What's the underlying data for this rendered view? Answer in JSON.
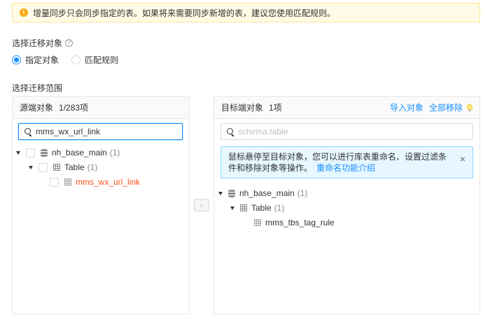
{
  "notice": {
    "text": "增量同步只会同步指定的表。如果将来需要同步新增的表，建议您使用匹配规则。",
    "icon": "exclamation-circle-icon"
  },
  "object_section": {
    "label": "选择迁移对象",
    "help_glyph": "?",
    "options": [
      {
        "label": "指定对象",
        "checked": true
      },
      {
        "label": "匹配规则",
        "checked": false
      }
    ]
  },
  "scope_section": {
    "label": "选择迁移范围"
  },
  "source_panel": {
    "title": "源端对象",
    "count": "1/283项",
    "search_value": "mms_wx_url_link",
    "tree": [
      {
        "label": "nh_base_main",
        "count": "(1)",
        "level": 0,
        "icon": "database-icon"
      },
      {
        "label": "Table",
        "count": "(1)",
        "level": 1,
        "icon": "table-group-icon"
      },
      {
        "label": "mms_wx_url_link",
        "count": "",
        "level": 2,
        "icon": "table-icon",
        "highlight": true
      }
    ]
  },
  "transfer_button": {
    "glyph": "›"
  },
  "target_panel": {
    "title": "目标端对象",
    "count": "1项",
    "import_label": "导入对象",
    "remove_all_label": "全部移除",
    "search_placeholder": "schema.table",
    "info_text": "鼠标悬停至目标对象，您可以进行库表重命名、设置过滤条件和移除对象等操作。",
    "info_link": "重命名功能介绍",
    "info_close": "×",
    "tree": [
      {
        "label": "nh_base_main",
        "count": "(1)",
        "level": 0,
        "icon": "database-icon"
      },
      {
        "label": "Table",
        "count": "(1)",
        "level": 1,
        "icon": "table-group-icon"
      },
      {
        "label": "mms_tbs_tag_rule",
        "count": "",
        "level": 2,
        "icon": "table-icon"
      }
    ]
  },
  "colors": {
    "primary": "#1890ff",
    "warning": "#faad14",
    "highlight": "#fa541c"
  }
}
